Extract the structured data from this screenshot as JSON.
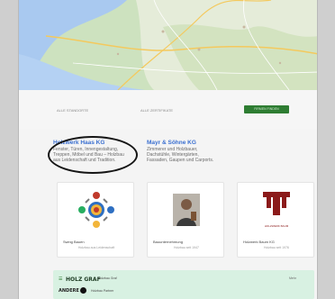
{
  "filters": {
    "left_label": "ALLE STANDORTE",
    "middle_label": "ALLE ZERTIFIKATE",
    "button_label": "FIRMEN FINDEN"
  },
  "companies_text": [
    {
      "name": "Holzwerk Haas KG",
      "description": "Fenster, Türen, Innengestaltung, Treppen, Möbel und Bau – Holzbau aus Leidenschaft und Tradition."
    },
    {
      "name": "Mayr & Söhne KG",
      "description": "Zimmerer und Holzbauer, Dachstühle, Wintergärten, Fassaden, Gaupen und Carports."
    }
  ],
  "cards": [
    {
      "name": "Swing Bauen",
      "subtitle": "Holzbau aus Leidenschaft"
    },
    {
      "name": "Bauunternehmung",
      "subtitle": "Holzbau seit 1947"
    },
    {
      "name": "Holzwerk Baum KG",
      "subtitle": "Holzbau seit 1976",
      "logo_caption": "HOLZWERK BAUM"
    }
  ],
  "banner": {
    "brand": "HOLZ GRAF",
    "brand_prefix": "☰",
    "tagline": "Holzbau Graf",
    "cta": "Mehr",
    "second_brand": "ANDERE",
    "second_text": "Holzbau Partner"
  },
  "colors": {
    "button": "#2e7d32",
    "link": "#3a6fd0",
    "banner": "#d8f1e2"
  }
}
